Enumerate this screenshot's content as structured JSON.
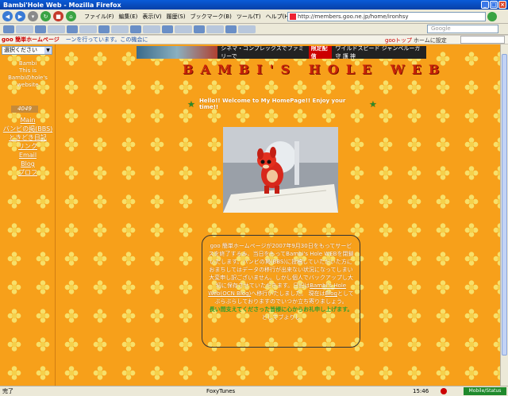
{
  "window": {
    "title": "Bambi'Hole Web - Mozilla Firefox"
  },
  "menu": [
    "ファイル(F)",
    "編集(E)",
    "表示(V)",
    "履歴(S)",
    "ブックマーク(B)",
    "ツール(T)",
    "ヘルプ(H)"
  ],
  "address": {
    "url": "http://members.goo.ne.jp/home/ironhsy"
  },
  "search": {
    "placeholder": "Google"
  },
  "goo_toolbar": {
    "logo": "goo 簡単ホームページ",
    "ticker": "ーンを行っています。この機会に",
    "goo_top": "gooトップ",
    "home_setting": "ホームに設定"
  },
  "sidebar": {
    "select_label": "選択ください",
    "intro_lines": [
      "Bambi",
      "This is",
      "Bambiのhole's website"
    ],
    "counter": "4049",
    "links": [
      {
        "label": "Main"
      },
      {
        "label": "バンビの掲(BBS)"
      },
      {
        "label": "ときどき日記"
      },
      {
        "label": "リンク"
      },
      {
        "label": "Email"
      },
      {
        "label": "Blog"
      },
      {
        "label": "プロフ"
      }
    ]
  },
  "banner": {
    "text": "シネマ・コンプレックスでファミリーで",
    "badge": "限定配信",
    "promo": "ワイルドスピード ジャンベルーガ 守 護 神"
  },
  "main": {
    "site_title": "BAMBI'S HOLE WEB",
    "welcome": "Hello!! Welcome to My HomePage!! Enjoy your time!!",
    "photo_alt": "red toy deer on a desk",
    "notice": {
      "text_1": "goo 簡単ホームページが2007年9月30日をもってサービスを終了するみ、当日をもってBambi's Hole WEBを閉鎖いたします。バンビの掲(BBS)に投稿していただいた方におまちしてはデータの移行が出来ない状況になってしまい大変申し訳ございません。しかし個人でバックアップし大切に保存させていただきます。日記は",
      "link_1": "Bambi's Hole Web(OCN Blog)",
      "text_2": "へ移行いたしました。 現在は",
      "link_2": "Blog",
      "text_3": "としてぶらぶらしておりますのでいつか立ち寄りましょう。",
      "green": "長い間支えてくださった皆様に心からお礼申し上げます。",
      "closing": "としてブよりし"
    }
  },
  "statusbar": {
    "left": "完了",
    "foxy": "FoxyTunes",
    "time": "15:46",
    "record": "Mobile/Status"
  }
}
